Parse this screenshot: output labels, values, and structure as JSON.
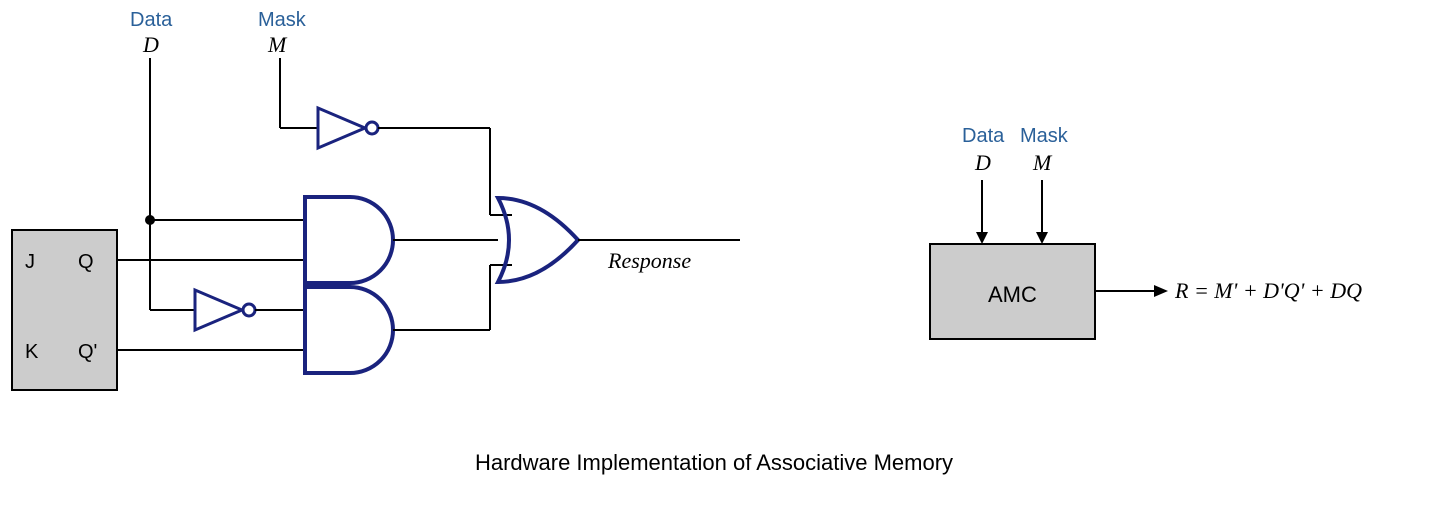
{
  "left": {
    "data_label": "Data",
    "data_var": "D",
    "mask_label": "Mask",
    "mask_var": "M",
    "ff_J": "J",
    "ff_K": "K",
    "ff_Q": "Q",
    "ff_Qp": "Q'",
    "response": "Response"
  },
  "right": {
    "data_label": "Data",
    "data_var": "D",
    "mask_label": "Mask",
    "mask_var": "M",
    "amc": "AMC",
    "equation": "R = M' + D'Q' + DQ"
  },
  "caption": "Hardware Implementation of Associative Memory",
  "colors": {
    "gate": "#1a237e",
    "box_fill": "#cccccc",
    "box_stroke": "#000000",
    "wire": "#000000",
    "blue_text": "#2a6099"
  }
}
